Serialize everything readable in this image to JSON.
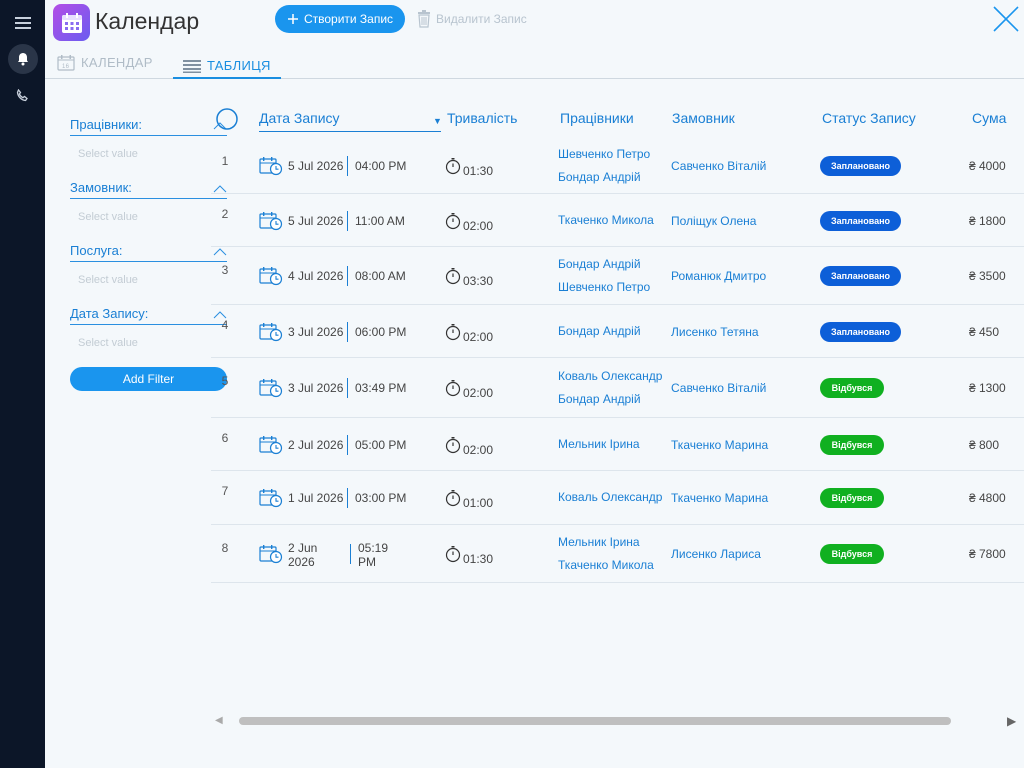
{
  "app": {
    "title": "Календар"
  },
  "toolbar": {
    "create_label": "Створити Запис",
    "delete_label": "Видалити Запис"
  },
  "tabs": [
    {
      "label": "КАЛЕНДАР"
    },
    {
      "label": "ТАБЛИЦЯ"
    }
  ],
  "filters": [
    {
      "label": "Працівники:",
      "placeholder": "Select value"
    },
    {
      "label": "Замовник:",
      "placeholder": "Select value"
    },
    {
      "label": "Послуга:",
      "placeholder": "Select value"
    },
    {
      "label": "Дата Запису:",
      "placeholder": "Select value"
    }
  ],
  "add_filter_label": "Add Filter",
  "columns": [
    "Дата Запису",
    "Тривалість",
    "Працівники",
    "Замовник",
    "Статус Запису",
    "Сума"
  ],
  "rows": [
    {
      "num": "1",
      "date": "5 Jul 2026",
      "time": "04:00 PM",
      "duration": "01:30",
      "worker1": "Шевченко Петро",
      "worker2": "Бондар Андрій",
      "client": "Савченко Віталій",
      "status": "Заплановано",
      "sum": "₴ 4000"
    },
    {
      "num": "2",
      "date": "5 Jul 2026",
      "time": "11:00 AM",
      "duration": "02:00",
      "worker1": "Ткаченко Микола",
      "worker2": "",
      "client": "Поліщук Олена",
      "status": "Заплановано",
      "sum": "₴ 1800"
    },
    {
      "num": "3",
      "date": "4 Jul 2026",
      "time": "08:00 AM",
      "duration": "03:30",
      "worker1": "Бондар Андрій",
      "worker2": "Шевченко Петро",
      "client": "Романюк Дмитро",
      "status": "Заплановано",
      "sum": "₴ 3500"
    },
    {
      "num": "4",
      "date": "3 Jul 2026",
      "time": "06:00 PM",
      "duration": "02:00",
      "worker1": "Бондар Андрій",
      "worker2": "",
      "client": "Лисенко Тетяна",
      "status": "Заплановано",
      "sum": "₴ 450"
    },
    {
      "num": "5",
      "date": "3 Jul 2026",
      "time": "03:49 PM",
      "duration": "02:00",
      "worker1": "Коваль Олександр",
      "worker2": "Бондар Андрій",
      "client": "Савченко Віталій",
      "status": "Відбувся",
      "sum": "₴ 1300"
    },
    {
      "num": "6",
      "date": "2 Jul 2026",
      "time": "05:00 PM",
      "duration": "02:00",
      "worker1": "Мельник Ірина",
      "worker2": "",
      "client": "Ткаченко Марина",
      "status": "Відбувся",
      "sum": "₴ 800"
    },
    {
      "num": "7",
      "date": "1 Jul 2026",
      "time": "03:00 PM",
      "duration": "01:00",
      "worker1": "Коваль Олександр",
      "worker2": "",
      "client": "Ткаченко Марина",
      "status": "Відбувся",
      "sum": "₴ 4800"
    },
    {
      "num": "8",
      "date": "2 Jun 2026",
      "time": "05:19 PM",
      "duration": "01:30",
      "worker1": "Мельник Ірина",
      "worker2": "Ткаченко Микола",
      "client": "Лисенко Лариса",
      "status": "Відбувся",
      "sum": "₴ 7800"
    }
  ],
  "colors": {
    "accent": "#1a95ee",
    "scheduled": "#0d5fd8",
    "done": "#10b020",
    "rail": "#0c1628"
  }
}
